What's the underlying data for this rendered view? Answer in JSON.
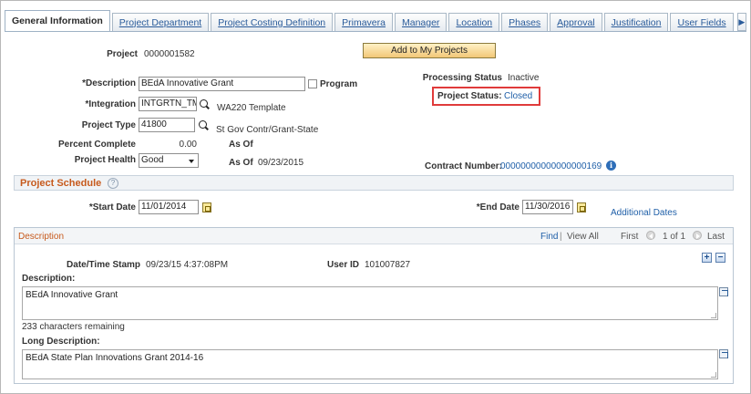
{
  "tabs": [
    {
      "label": "General Information",
      "active": true
    },
    {
      "label": "Project Department",
      "active": false
    },
    {
      "label": "Project Costing Definition",
      "active": false
    },
    {
      "label": "Primavera",
      "active": false
    },
    {
      "label": "Manager",
      "active": false
    },
    {
      "label": "Location",
      "active": false
    },
    {
      "label": "Phases",
      "active": false
    },
    {
      "label": "Approval",
      "active": false
    },
    {
      "label": "Justification",
      "active": false
    },
    {
      "label": "User Fields",
      "active": false
    }
  ],
  "header": {
    "project_label": "Project",
    "project_value": "0000001582",
    "add_button": "Add to My Projects"
  },
  "general": {
    "description_label": "*Description",
    "description_value": "BEdA Innovative Grant",
    "program_label": "Program",
    "integration_label": "*Integration",
    "integration_value": "INTGRTN_TM",
    "integration_desc": "WA220 Template",
    "project_type_label": "Project Type",
    "project_type_value": "41800",
    "project_type_desc": "St Gov Contr/Grant-State",
    "percent_complete_label": "Percent Complete",
    "percent_complete_value": "0.00",
    "as_of_label_1": "As Of",
    "project_health_label": "Project Health",
    "project_health_value": "Good",
    "as_of_label_2": "As Of",
    "as_of_date": "09/23/2015",
    "processing_status_label": "Processing Status",
    "processing_status_value": "Inactive",
    "project_status_label": "Project Status:",
    "project_status_value": "Closed",
    "contract_number_label": "Contract Number:",
    "contract_number_value": "00000000000000000169"
  },
  "schedule": {
    "title": "Project Schedule",
    "start_date_label": "*Start Date",
    "start_date_value": "11/01/2014",
    "end_date_label": "*End Date",
    "end_date_value": "11/30/2016",
    "additional_dates": "Additional Dates"
  },
  "description_grid": {
    "title": "Description",
    "find": "Find",
    "view_all": "View All",
    "separator": "|",
    "first": "First",
    "range": "1 of 1",
    "last": "Last",
    "timestamp_label": "Date/Time Stamp",
    "timestamp_value": "09/23/15  4:37:08PM",
    "user_id_label": "User ID",
    "user_id_value": "101007827",
    "description_label": "Description:",
    "description_value": "BEdA Innovative Grant",
    "chars_remaining": "233 characters remaining",
    "long_description_label": "Long Description:",
    "long_description_value": "BEdA State Plan Innovations Grant 2014-16",
    "add_symbol": "+",
    "remove_symbol": "−"
  },
  "icons": {
    "help_glyph": "?",
    "info_glyph": "i",
    "tab_scroll_glyph": "▶"
  },
  "colors": {
    "link": "#1f5fa8",
    "section_title": "#c75a1d",
    "highlight": "#e03b3b",
    "button": "#f2c777"
  }
}
